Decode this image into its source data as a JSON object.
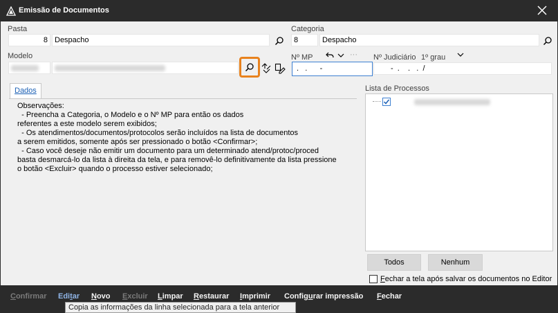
{
  "window": {
    "title": "Emissão de Documentos"
  },
  "pasta": {
    "label": "Pasta",
    "code": "8",
    "name": "Despacho"
  },
  "categoria": {
    "label": "Categoria",
    "code": "8",
    "name": "Despacho"
  },
  "modelo": {
    "label": "Modelo",
    "code": "",
    "name": ""
  },
  "mp": {
    "label": "Nº MP",
    "value": " .   .      -"
  },
  "judiciario": {
    "label": "Nº Judiciário",
    "grau": "1º grau",
    "value": "-  .    .   .  /"
  },
  "tabs": {
    "dados": "Dados"
  },
  "observacoes": "Observações:\n  - Preencha a Categoria, o Modelo e o Nº MP para então os dados\nreferentes a este modelo serem exibidos;\n  - Os atendimentos/documentos/protocolos serão incluídos na lista de documentos\na serem emitidos, somente após ser pressionado o botão <Confirmar>;\n  - Caso você deseje não emitir um documento para um determinado atend/protoc/proced\nbasta desmarcá-lo da lista à direita da tela, e para removê-lo definitivamente da lista pressione\no botão <Excluir> quando o processo estiver selecionado;",
  "lista": {
    "label": "Lista de Processos",
    "item_checked": true
  },
  "buttons": {
    "todos": "Todos",
    "nenhum": "Nenhum"
  },
  "fechar_check": {
    "label_prefix": "F",
    "label_rest": "echar a tela após salvar os documentos no Editor",
    "checked": false
  },
  "toolbar": {
    "confirmar": {
      "u": "C",
      "rest": "onfirmar"
    },
    "editar": {
      "pre": "Edi",
      "u": "t",
      "rest": "ar"
    },
    "novo": {
      "u": "N",
      "rest": "ovo"
    },
    "excluir": {
      "u": "E",
      "rest": "xcluir"
    },
    "limpar": {
      "u": "L",
      "rest": "impar"
    },
    "restaurar": {
      "u": "R",
      "rest": "estaurar"
    },
    "imprimir": {
      "u": "I",
      "rest": "mprimir"
    },
    "configurar": {
      "pre": "Config",
      "u": "u",
      "rest": "rar impressão"
    },
    "fechar": {
      "u": "F",
      "rest": "echar"
    }
  },
  "tooltip": "Copia as informações da linha selecionada para a tela anterior",
  "colors": {
    "accent": "#e8821e",
    "title_bg": "#2b2b2b",
    "link": "#1a5fb4"
  },
  "icons": [
    "app-triangle-icon",
    "close-icon",
    "search-icon",
    "link-model-icon",
    "edit-model-icon",
    "undo-icon",
    "chevron-down-icon",
    "ellipsis-icon",
    "check-icon"
  ]
}
